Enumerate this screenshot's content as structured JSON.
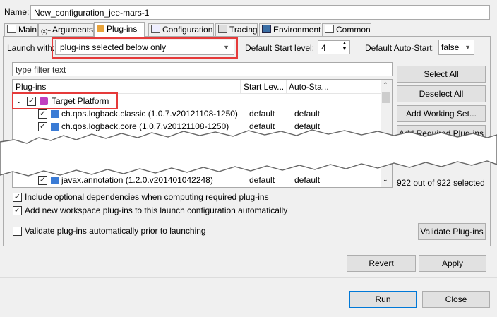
{
  "name": {
    "label": "Name:",
    "value": "New_configuration_jee-mars-1"
  },
  "tabs": [
    {
      "label": "Main",
      "icon": "main-tab-icon"
    },
    {
      "label": "Arguments",
      "icon": "arguments-icon"
    },
    {
      "label": "Plug-ins",
      "icon": "plugin-icon"
    },
    {
      "label": "Configuration",
      "icon": "configuration-icon"
    },
    {
      "label": "Tracing",
      "icon": "tracing-icon"
    },
    {
      "label": "Environment",
      "icon": "environment-icon"
    },
    {
      "label": "Common",
      "icon": "common-icon"
    }
  ],
  "launch": {
    "label": "Launch with:",
    "value": "plug-ins selected below only"
  },
  "start_level": {
    "label": "Default Start level:",
    "value": "4"
  },
  "auto_start": {
    "label": "Default Auto-Start:",
    "value": "false"
  },
  "filter": {
    "placeholder": "type filter text"
  },
  "table": {
    "columns": [
      "Plug-ins",
      "Start Lev...",
      "Auto-Sta..."
    ],
    "root": {
      "label": "Target Platform",
      "checked": true,
      "expanded": true
    },
    "rows": [
      {
        "name": "ch.qos.logback.classic (1.0.7.v20121108-1250)",
        "start": "default",
        "auto": "default",
        "checked": true
      },
      {
        "name": "ch.qos.logback.core (1.0.7.v20121108-1250)",
        "start": "default",
        "auto": "default",
        "checked": true
      },
      {
        "name": "javax.annotation (1.2.0.v201401042248)",
        "start": "default",
        "auto": "default",
        "checked": true
      }
    ]
  },
  "side_buttons": [
    "Select All",
    "Deselect All",
    "Add Working Set...",
    "Add Required Plug-ins"
  ],
  "selected_count": "922 out of 922 selected",
  "options": [
    {
      "label": "Include optional dependencies when computing required plug-ins",
      "checked": true
    },
    {
      "label": "Add new workspace plug-ins to this launch configuration automatically",
      "checked": true
    },
    {
      "label": "Validate plug-ins automatically prior to launching",
      "checked": false
    }
  ],
  "validate_button": "Validate Plug-ins",
  "revert_button": "Revert",
  "apply_button": "Apply",
  "run_button": "Run",
  "close_button": "Close",
  "colors": {
    "highlight": "#e53a3a",
    "selected_tab": "#ffffff",
    "plugin_icon": "#3a7bd5"
  }
}
